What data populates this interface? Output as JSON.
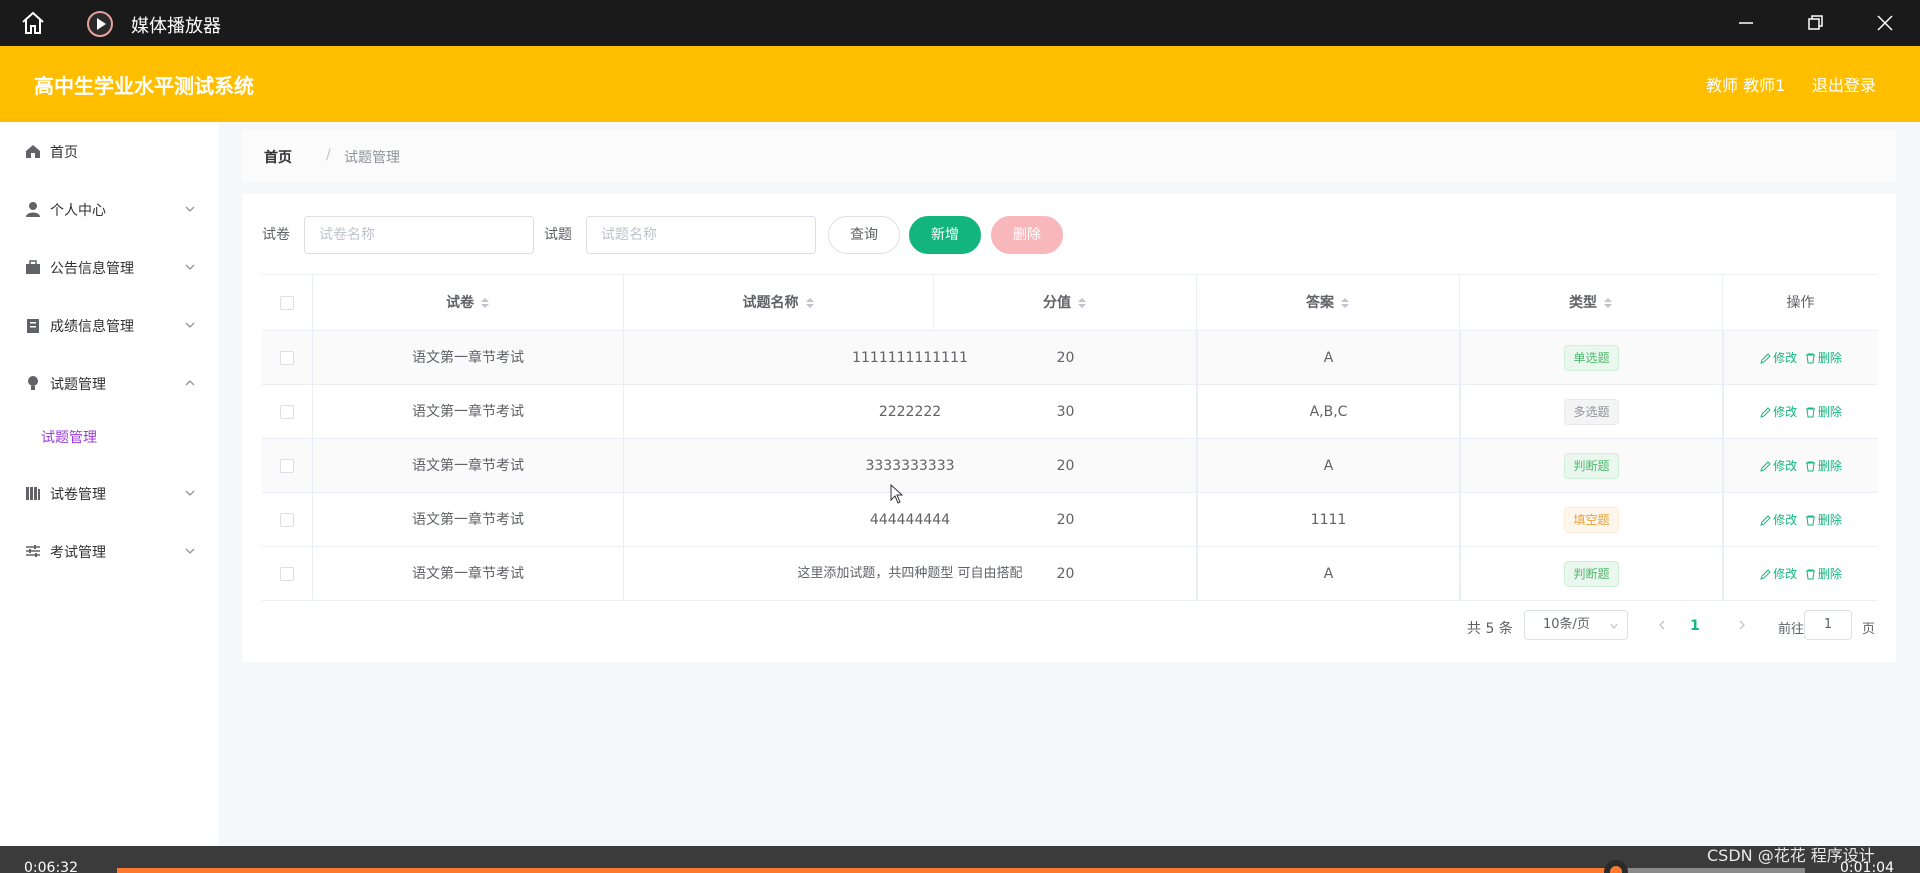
{
  "player": {
    "title": "媒体播放器",
    "time_elapsed": "0:06:32",
    "time_remaining": "0:01:04",
    "progress": 0.888
  },
  "header": {
    "system_title": "高中生学业水平测试系统",
    "user": "教师 教师1",
    "logout": "退出登录"
  },
  "sidebar": {
    "items": [
      {
        "label": "首页",
        "icon": "home-icon"
      },
      {
        "label": "个人中心",
        "icon": "user-icon"
      },
      {
        "label": "公告信息管理",
        "icon": "briefcase-icon"
      },
      {
        "label": "成绩信息管理",
        "icon": "clipboard-icon"
      },
      {
        "label": "试题管理",
        "icon": "bulb-icon"
      },
      {
        "label": "试卷管理",
        "icon": "books-icon"
      },
      {
        "label": "考试管理",
        "icon": "sliders-icon"
      }
    ],
    "active_sub": "试题管理"
  },
  "breadcrumb": {
    "home": "首页",
    "separator": "/",
    "current": "试题管理"
  },
  "filters": {
    "paper_label": "试卷",
    "paper_placeholder": "试卷名称",
    "question_label": "试题",
    "question_placeholder": "试题名称",
    "query": "查询",
    "add": "新增",
    "delete": "删除"
  },
  "table": {
    "columns": [
      "试卷",
      "试题名称",
      "分值",
      "答案",
      "类型",
      "操作"
    ],
    "rows": [
      {
        "paper": "语文第一章节考试",
        "name": "1111111111111",
        "score": "20",
        "answer": "A",
        "type": "单选题",
        "type_color": "green"
      },
      {
        "paper": "语文第一章节考试",
        "name": "2222222",
        "score": "30",
        "answer": "A,B,C",
        "type": "多选题",
        "type_color": "gray"
      },
      {
        "paper": "语文第一章节考试",
        "name": "3333333333",
        "score": "20",
        "answer": "A",
        "type": "判断题",
        "type_color": "green"
      },
      {
        "paper": "语文第一章节考试",
        "name": "444444444",
        "score": "20",
        "answer": "1111",
        "type": "填空题",
        "type_color": "orange"
      },
      {
        "paper": "语文第一章节考试",
        "name": "这里添加试题，共四种题型 可自由搭配",
        "score": "20",
        "answer": "A",
        "type": "判断题",
        "type_color": "green"
      }
    ],
    "edit_label": "修改",
    "delete_label": "删除"
  },
  "pagination": {
    "total": "共 5 条",
    "page_size": "10条/页",
    "current_page": "1",
    "goto_label": "前往",
    "goto_value": "1",
    "page_suffix": "页"
  },
  "watermark": "CSDN @花花 程序设计",
  "colors": {
    "header": "#ffbf00",
    "primary": "#13b57f",
    "danger_light": "#f7b7bb",
    "sub_active": "#9b3fd6"
  }
}
